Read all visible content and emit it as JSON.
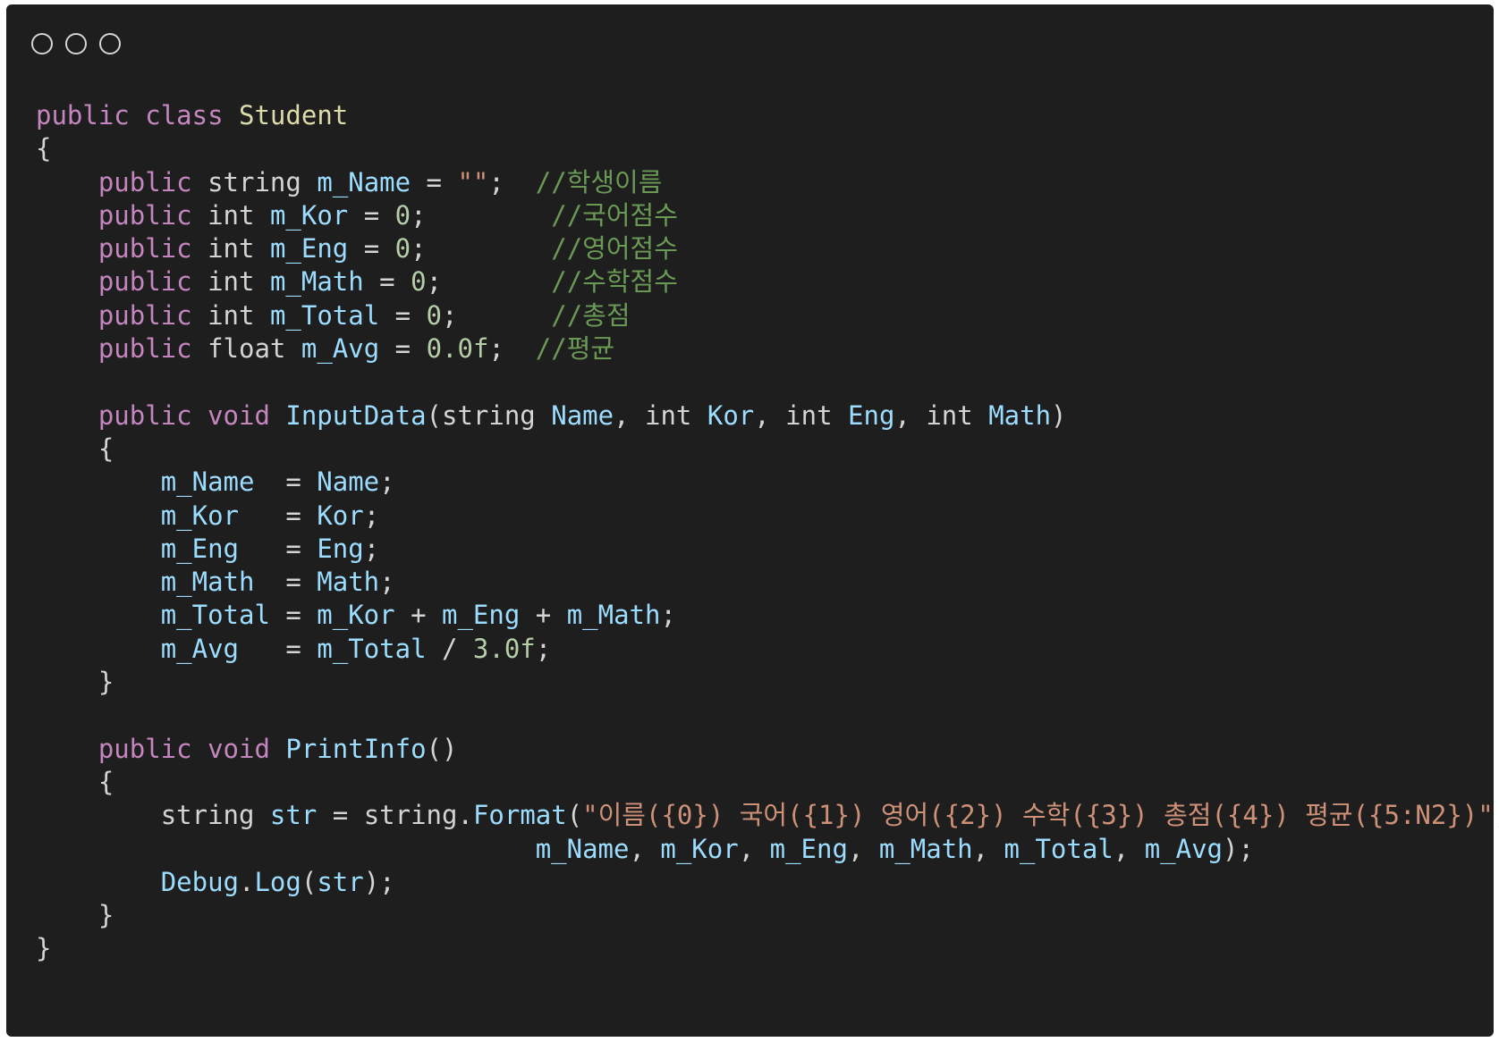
{
  "window": {
    "controls": [
      "close",
      "minimize",
      "maximize"
    ]
  },
  "code_lines": [
    [
      [
        "kw",
        "public"
      ],
      [
        "ws",
        " "
      ],
      [
        "kw",
        "class"
      ],
      [
        "ws",
        " "
      ],
      [
        "cls",
        "Student"
      ]
    ],
    [
      [
        "pun",
        "{"
      ]
    ],
    [
      [
        "ws",
        "    "
      ],
      [
        "kw",
        "public"
      ],
      [
        "ws",
        " "
      ],
      [
        "type",
        "string"
      ],
      [
        "ws",
        " "
      ],
      [
        "var",
        "m_Name"
      ],
      [
        "pun",
        " = "
      ],
      [
        "str",
        "\"\""
      ],
      [
        "pun",
        ";"
      ],
      [
        "ws",
        "  "
      ],
      [
        "cmt",
        "//학생이름"
      ]
    ],
    [
      [
        "ws",
        "    "
      ],
      [
        "kw",
        "public"
      ],
      [
        "ws",
        " "
      ],
      [
        "type",
        "int"
      ],
      [
        "ws",
        " "
      ],
      [
        "var",
        "m_Kor"
      ],
      [
        "pun",
        " = "
      ],
      [
        "num",
        "0"
      ],
      [
        "pun",
        ";"
      ],
      [
        "ws",
        "        "
      ],
      [
        "cmt",
        "//국어점수"
      ]
    ],
    [
      [
        "ws",
        "    "
      ],
      [
        "kw",
        "public"
      ],
      [
        "ws",
        " "
      ],
      [
        "type",
        "int"
      ],
      [
        "ws",
        " "
      ],
      [
        "var",
        "m_Eng"
      ],
      [
        "pun",
        " = "
      ],
      [
        "num",
        "0"
      ],
      [
        "pun",
        ";"
      ],
      [
        "ws",
        "        "
      ],
      [
        "cmt",
        "//영어점수"
      ]
    ],
    [
      [
        "ws",
        "    "
      ],
      [
        "kw",
        "public"
      ],
      [
        "ws",
        " "
      ],
      [
        "type",
        "int"
      ],
      [
        "ws",
        " "
      ],
      [
        "var",
        "m_Math"
      ],
      [
        "pun",
        " = "
      ],
      [
        "num",
        "0"
      ],
      [
        "pun",
        ";"
      ],
      [
        "ws",
        "       "
      ],
      [
        "cmt",
        "//수학점수"
      ]
    ],
    [
      [
        "ws",
        "    "
      ],
      [
        "kw",
        "public"
      ],
      [
        "ws",
        " "
      ],
      [
        "type",
        "int"
      ],
      [
        "ws",
        " "
      ],
      [
        "var",
        "m_Total"
      ],
      [
        "pun",
        " = "
      ],
      [
        "num",
        "0"
      ],
      [
        "pun",
        ";"
      ],
      [
        "ws",
        "      "
      ],
      [
        "cmt",
        "//총점"
      ]
    ],
    [
      [
        "ws",
        "    "
      ],
      [
        "kw",
        "public"
      ],
      [
        "ws",
        " "
      ],
      [
        "type",
        "float"
      ],
      [
        "ws",
        " "
      ],
      [
        "var",
        "m_Avg"
      ],
      [
        "pun",
        " = "
      ],
      [
        "num",
        "0.0f"
      ],
      [
        "pun",
        ";"
      ],
      [
        "ws",
        "  "
      ],
      [
        "cmt",
        "//평균"
      ]
    ],
    [],
    [
      [
        "ws",
        "    "
      ],
      [
        "kw",
        "public"
      ],
      [
        "ws",
        " "
      ],
      [
        "kw",
        "void"
      ],
      [
        "ws",
        " "
      ],
      [
        "fn",
        "InputData"
      ],
      [
        "pun",
        "("
      ],
      [
        "type",
        "string"
      ],
      [
        "ws",
        " "
      ],
      [
        "var",
        "Name"
      ],
      [
        "pun",
        ", "
      ],
      [
        "type",
        "int"
      ],
      [
        "ws",
        " "
      ],
      [
        "var",
        "Kor"
      ],
      [
        "pun",
        ", "
      ],
      [
        "type",
        "int"
      ],
      [
        "ws",
        " "
      ],
      [
        "var",
        "Eng"
      ],
      [
        "pun",
        ", "
      ],
      [
        "type",
        "int"
      ],
      [
        "ws",
        " "
      ],
      [
        "var",
        "Math"
      ],
      [
        "pun",
        ")"
      ]
    ],
    [
      [
        "ws",
        "    "
      ],
      [
        "pun",
        "{"
      ]
    ],
    [
      [
        "ws",
        "        "
      ],
      [
        "var",
        "m_Name"
      ],
      [
        "pun",
        "  = "
      ],
      [
        "var",
        "Name"
      ],
      [
        "pun",
        ";"
      ]
    ],
    [
      [
        "ws",
        "        "
      ],
      [
        "var",
        "m_Kor"
      ],
      [
        "pun",
        "   = "
      ],
      [
        "var",
        "Kor"
      ],
      [
        "pun",
        ";"
      ]
    ],
    [
      [
        "ws",
        "        "
      ],
      [
        "var",
        "m_Eng"
      ],
      [
        "pun",
        "   = "
      ],
      [
        "var",
        "Eng"
      ],
      [
        "pun",
        ";"
      ]
    ],
    [
      [
        "ws",
        "        "
      ],
      [
        "var",
        "m_Math"
      ],
      [
        "pun",
        "  = "
      ],
      [
        "var",
        "Math"
      ],
      [
        "pun",
        ";"
      ]
    ],
    [
      [
        "ws",
        "        "
      ],
      [
        "var",
        "m_Total"
      ],
      [
        "pun",
        " = "
      ],
      [
        "var",
        "m_Kor"
      ],
      [
        "pun",
        " + "
      ],
      [
        "var",
        "m_Eng"
      ],
      [
        "pun",
        " + "
      ],
      [
        "var",
        "m_Math"
      ],
      [
        "pun",
        ";"
      ]
    ],
    [
      [
        "ws",
        "        "
      ],
      [
        "var",
        "m_Avg"
      ],
      [
        "pun",
        "   = "
      ],
      [
        "var",
        "m_Total"
      ],
      [
        "pun",
        " / "
      ],
      [
        "num",
        "3.0f"
      ],
      [
        "pun",
        ";"
      ]
    ],
    [
      [
        "ws",
        "    "
      ],
      [
        "pun",
        "}"
      ]
    ],
    [],
    [
      [
        "ws",
        "    "
      ],
      [
        "kw",
        "public"
      ],
      [
        "ws",
        " "
      ],
      [
        "kw",
        "void"
      ],
      [
        "ws",
        " "
      ],
      [
        "fn",
        "PrintInfo"
      ],
      [
        "pun",
        "()"
      ]
    ],
    [
      [
        "ws",
        "    "
      ],
      [
        "pun",
        "{"
      ]
    ],
    [
      [
        "ws",
        "        "
      ],
      [
        "type",
        "string"
      ],
      [
        "ws",
        " "
      ],
      [
        "var",
        "str"
      ],
      [
        "pun",
        " = "
      ],
      [
        "type",
        "string"
      ],
      [
        "pun",
        "."
      ],
      [
        "fn",
        "Format"
      ],
      [
        "pun",
        "("
      ],
      [
        "str",
        "\"이름({0}) 국어({1}) 영어({2}) 수학({3}) 총점({4}) 평균({5:N2})\""
      ],
      [
        "pun",
        ","
      ]
    ],
    [
      [
        "ws",
        "                                "
      ],
      [
        "var",
        "m_Name"
      ],
      [
        "pun",
        ", "
      ],
      [
        "var",
        "m_Kor"
      ],
      [
        "pun",
        ", "
      ],
      [
        "var",
        "m_Eng"
      ],
      [
        "pun",
        ", "
      ],
      [
        "var",
        "m_Math"
      ],
      [
        "pun",
        ", "
      ],
      [
        "var",
        "m_Total"
      ],
      [
        "pun",
        ", "
      ],
      [
        "var",
        "m_Avg"
      ],
      [
        "pun",
        ");"
      ]
    ],
    [
      [
        "ws",
        "        "
      ],
      [
        "fn",
        "Debug"
      ],
      [
        "pun",
        "."
      ],
      [
        "fn",
        "Log"
      ],
      [
        "pun",
        "("
      ],
      [
        "var",
        "str"
      ],
      [
        "pun",
        ");"
      ]
    ],
    [
      [
        "ws",
        "    "
      ],
      [
        "pun",
        "}"
      ]
    ],
    [
      [
        "pun",
        "}"
      ]
    ]
  ]
}
